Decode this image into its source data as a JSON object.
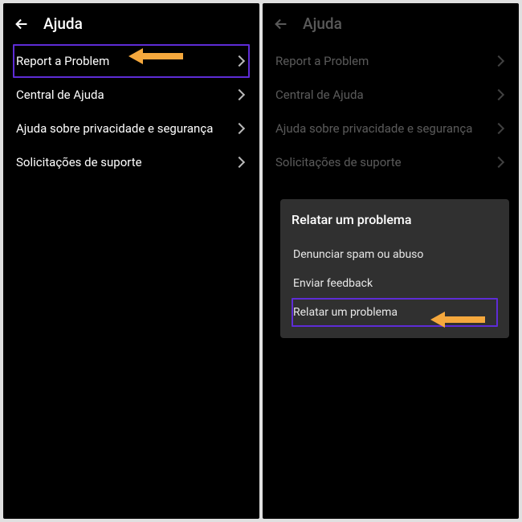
{
  "left": {
    "title": "Ajuda",
    "items": [
      {
        "label": "Report a Problem"
      },
      {
        "label": "Central de Ajuda"
      },
      {
        "label": "Ajuda sobre privacidade e segurança"
      },
      {
        "label": "Solicitações de suporte"
      }
    ]
  },
  "right": {
    "title": "Ajuda",
    "items": [
      {
        "label": "Report a Problem"
      },
      {
        "label": "Central de Ajuda"
      },
      {
        "label": "Ajuda sobre privacidade e segurança"
      },
      {
        "label": "Solicitações de suporte"
      }
    ],
    "dialog": {
      "title": "Relatar um problema",
      "options": [
        {
          "label": "Denunciar spam ou abuso"
        },
        {
          "label": "Enviar feedback"
        },
        {
          "label": "Relatar um problema"
        }
      ]
    }
  },
  "colors": {
    "highlight_border": "#5e2cd6",
    "arrow": "#f5a83d"
  }
}
